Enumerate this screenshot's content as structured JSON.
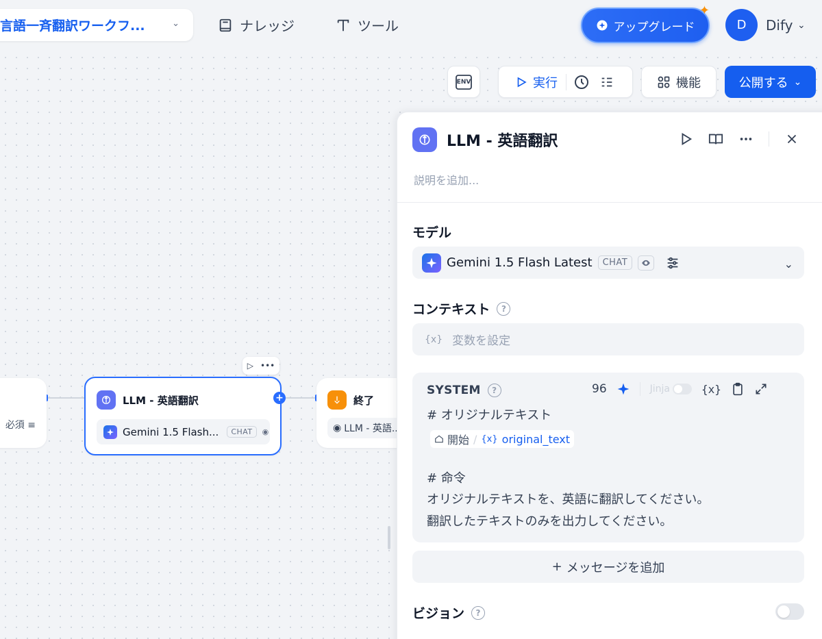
{
  "app": {
    "title": "言語一斉翻訳ワークフ...",
    "nav": {
      "knowledge": "ナレッジ",
      "tools": "ツール"
    },
    "upgrade_label": "アップグレード",
    "user": {
      "initial": "D",
      "name": "Dify"
    }
  },
  "toolbar": {
    "env_label": "ENV",
    "run_label": "実行",
    "features_label": "機能",
    "publish_label": "公開する"
  },
  "canvas": {
    "start_node": {
      "chip_text": "必須"
    },
    "llm_node": {
      "title": "LLM - 英語翻訳",
      "model": "Gemini 1.5 Flash...",
      "tag": "CHAT"
    },
    "end_node": {
      "title": "終了",
      "output": "LLM - 英語..."
    }
  },
  "panel": {
    "title": "LLM - 英語翻訳",
    "description_placeholder": "説明を追加...",
    "model_section": {
      "label": "モデル",
      "model_name": "Gemini 1.5 Flash Latest",
      "tag": "CHAT"
    },
    "context_section": {
      "label": "コンテキスト",
      "placeholder": "変数を設定",
      "var_symbol": "{x}"
    },
    "system_prompt": {
      "label": "SYSTEM",
      "char_count": "96",
      "jinja_label": "Jinja",
      "var_button": "{x}",
      "line1": "# オリジナルテキスト",
      "var_source": "開始",
      "var_name": "original_text",
      "line3": "# 命令",
      "line4": "オリジナルテキストを、英語に翻訳してください。",
      "line5": "翻訳したテキストのみを出力してください。"
    },
    "add_message_label": "メッセージを追加",
    "vision_section": {
      "label": "ビジョン",
      "enabled": false
    }
  },
  "colors": {
    "primary": "#155eef",
    "llm_icon": "#6172f3",
    "end_icon": "#f79009"
  }
}
